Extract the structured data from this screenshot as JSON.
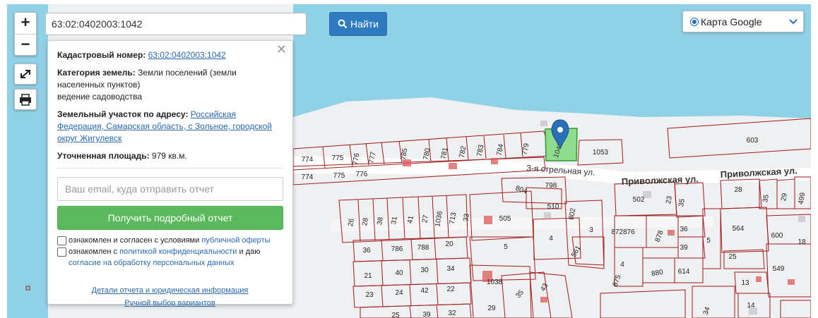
{
  "search": {
    "value": "63:02:0402003:1042",
    "button_label": "Найти"
  },
  "layer": {
    "label": "Карта Google"
  },
  "panel": {
    "cadastral_label": "Кадастровый номер:",
    "cadastral_value": "63:02:0402003:1042",
    "category_label": "Категория земель:",
    "category_value_1": "Земли поселений (земли",
    "category_value_2": "населенных пунктов)",
    "category_value_3": "ведение садоводства",
    "address_label": "Земельный участок по адресу:",
    "address_value_1": "Российская",
    "address_value_2": "Федерация, Самарская область, с Зольное, городской",
    "address_value_3": "округ Жигулевск",
    "area_label": "Уточненная площадь:",
    "area_value": "979 кв.м.",
    "email_placeholder": "Ваш email, куда отправить отчет",
    "report_button": "Получить подробный отчет",
    "agree1_text": "ознакомлен и согласен с условиями",
    "agree1_link": "публичной оферты",
    "agree2_text": "ознакомлен с",
    "agree2_link1": "политикой конфиденциальности",
    "agree2_mid": "и даю",
    "agree2_link2": "согласие на обработку персональных данных",
    "details_link": "Детали отчета и юридическая информация",
    "manual_link": "Ручной выбор вариантов"
  },
  "map": {
    "colors": {
      "water": "#8fd1e6",
      "land": "#eef0f2",
      "parcel": "#a21a1a",
      "selected": "#8fdc8f",
      "marker": "#2a6fb8"
    },
    "streets": [
      "3-я стрельная ул.",
      "Приволжская ул.",
      "Приволжская ул."
    ],
    "selected_parcel": "1042",
    "parcel_labels": [
      "774",
      "775",
      "776",
      "777",
      "785",
      "780",
      "781",
      "782",
      "783",
      "784",
      "779",
      "774",
      "775",
      "776",
      "1053",
      "603",
      "798",
      "804",
      "510",
      "802",
      "505",
      "3",
      "4",
      "561",
      "502",
      "23",
      "35",
      "872876",
      "878",
      "36",
      "39",
      "5",
      "875",
      "4",
      "880",
      "614",
      "28",
      "35",
      "29",
      "499",
      "564",
      "600",
      "18",
      "25",
      "549",
      "13",
      "14",
      "34",
      "26",
      "28",
      "38",
      "31",
      "41",
      "27",
      "1036",
      "713",
      "33",
      "36",
      "786",
      "788",
      "20",
      "21",
      "40",
      "30",
      "34",
      "23",
      "24",
      "42",
      "22",
      "25",
      "39",
      "32",
      "1038",
      "29",
      "35",
      "43",
      "5"
    ]
  }
}
